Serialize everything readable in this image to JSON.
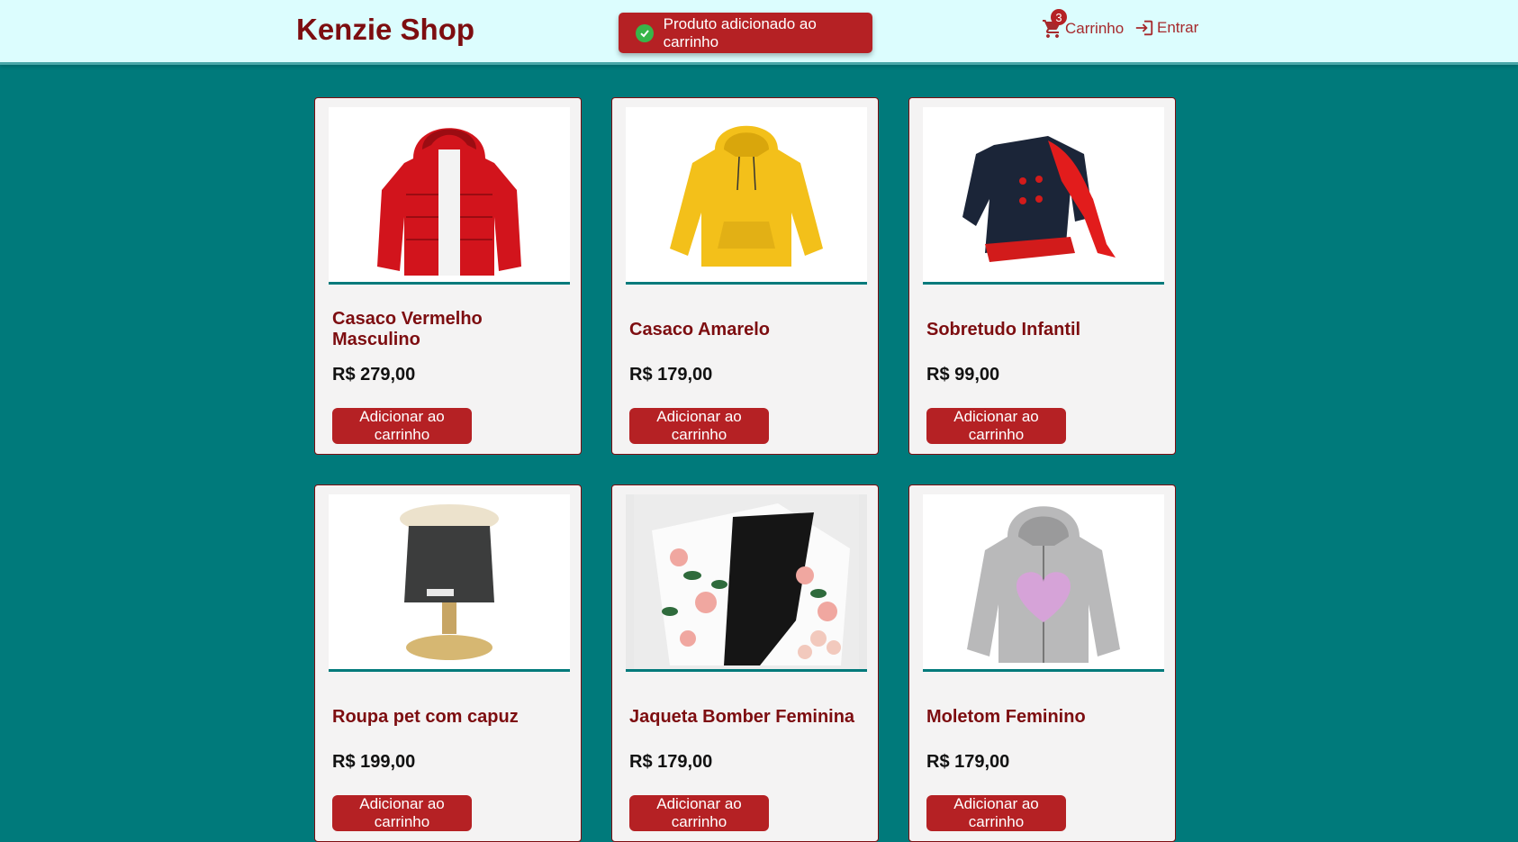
{
  "header": {
    "logo": "Kenzie Shop",
    "toast": "Produto adicionado ao carrinho",
    "cart_label": "Carrinho",
    "cart_count": "3",
    "login_label": "Entrar"
  },
  "products": [
    {
      "name": "Casaco Vermelho Masculino",
      "price": "R$ 279,00",
      "button": "Adicionar ao carrinho",
      "image": "red-puffer-jacket-image"
    },
    {
      "name": "Casaco Amarelo",
      "price": "R$ 179,00",
      "button": "Adicionar ao carrinho",
      "image": "yellow-hoodie-image"
    },
    {
      "name": "Sobretudo Infantil",
      "price": "R$ 99,00",
      "button": "Adicionar ao carrinho",
      "image": "kids-coat-image"
    },
    {
      "name": "Roupa pet com capuz",
      "price": "R$ 199,00",
      "button": "Adicionar ao carrinho",
      "image": "pet-hoodie-image"
    },
    {
      "name": "Jaqueta Bomber Feminina",
      "price": "R$ 179,00",
      "button": "Adicionar ao carrinho",
      "image": "floral-bomber-image"
    },
    {
      "name": "Moletom Feminino",
      "price": "R$ 179,00",
      "button": "Adicionar ao carrinho",
      "image": "gray-hoodie-image"
    }
  ],
  "colors": {
    "brand": "#7d0d10",
    "accent": "#b52124",
    "background": "#007a7b",
    "header": "#dcfdfe"
  }
}
